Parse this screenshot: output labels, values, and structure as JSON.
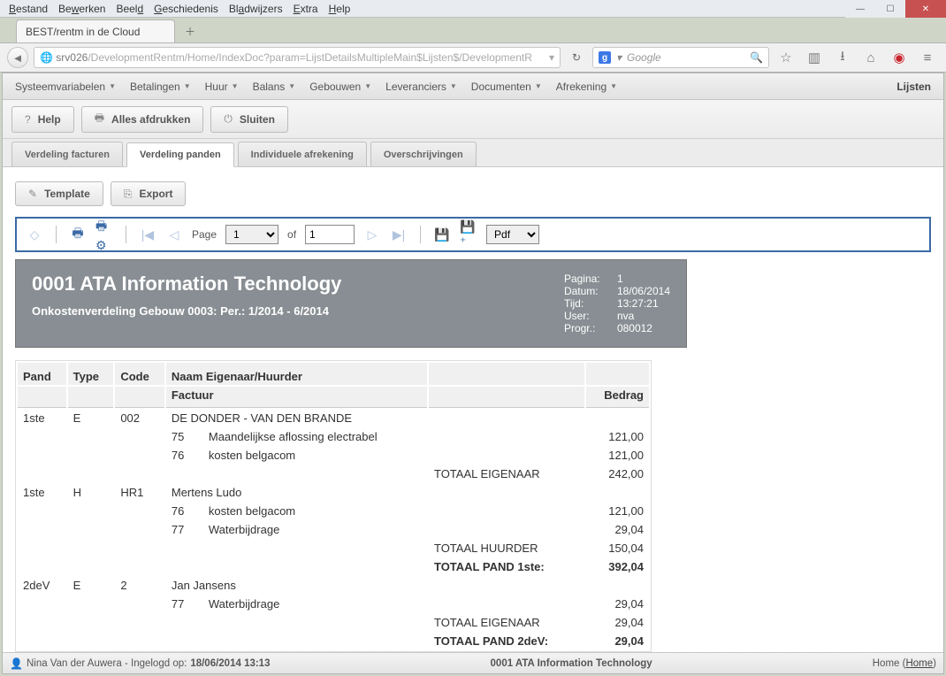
{
  "os_menu": [
    "Bestand",
    "Bewerken",
    "Beeld",
    "Geschiedenis",
    "Bladwijzers",
    "Extra",
    "Help"
  ],
  "browser": {
    "tab_title": "BEST/rentm in de Cloud",
    "url_host": "srv026",
    "url_path": "/DevelopmentRentm/Home/IndexDoc?param=LijstDetailsMultipleMain$Lijsten$/DevelopmentR",
    "search_placeholder": "Google"
  },
  "app_menu": [
    "Systeemvariabelen",
    "Betalingen",
    "Huur",
    "Balans",
    "Gebouwen",
    "Leveranciers",
    "Documenten",
    "Afrekening"
  ],
  "app_menu_right": "Lijsten",
  "actions": {
    "help": "Help",
    "print_all": "Alles afdrukken",
    "close": "Sluiten"
  },
  "sub_tabs": [
    "Verdeling facturen",
    "Verdeling panden",
    "Individuele afrekening",
    "Overschrijvingen"
  ],
  "active_sub_tab": 1,
  "tools": {
    "template": "Template",
    "export": "Export"
  },
  "pager": {
    "page_label": "Page",
    "page_value": "1",
    "of_label": "of",
    "total_value": "1",
    "format": "Pdf"
  },
  "report": {
    "title": "0001 ATA Information Technology",
    "subtitle": "Onkostenverdeling Gebouw 0003: Per.: 1/2014 - 6/2014",
    "meta": {
      "Pagina:": "1",
      "Datum:": "18/06/2014",
      "Tijd:": "13:27:21",
      "User:": "nva",
      "Progr.:": "080012"
    },
    "headers": {
      "pand": "Pand",
      "type": "Type",
      "code": "Code",
      "naam": "Naam Eigenaar/Huurder",
      "factuur": "Factuur",
      "bedrag": "Bedrag"
    },
    "rows": [
      {
        "pand": "1ste",
        "type": "E",
        "code": "002",
        "naam": "DE DONDER - VAN DEN BRANDE"
      },
      {
        "fnum": "75",
        "fdesc": "Maandelijkse aflossing electrabel",
        "amt": "121,00"
      },
      {
        "fnum": "76",
        "fdesc": "kosten belgacom",
        "amt": "121,00"
      },
      {
        "totlabel": "TOTAAL EIGENAAR",
        "amt": "242,00"
      },
      {
        "pand": "1ste",
        "type": "H",
        "code": "HR1",
        "naam": "Mertens Ludo"
      },
      {
        "fnum": "76",
        "fdesc": "kosten belgacom",
        "amt": "121,00"
      },
      {
        "fnum": "77",
        "fdesc": "Waterbijdrage",
        "amt": "29,04"
      },
      {
        "totlabel": "TOTAAL HUURDER",
        "amt": "150,04"
      },
      {
        "totlabel": "TOTAAL PAND 1ste:",
        "amt": "392,04",
        "bold": true
      },
      {
        "pand": "2deV",
        "type": "E",
        "code": "2",
        "naam": "Jan Jansens"
      },
      {
        "fnum": "77",
        "fdesc": "Waterbijdrage",
        "amt": "29,04"
      },
      {
        "totlabel": "TOTAAL EIGENAAR",
        "amt": "29,04"
      },
      {
        "totlabel": "TOTAAL PAND 2deV:",
        "amt": "29,04",
        "bold": true
      }
    ]
  },
  "status": {
    "user_line_prefix": "Nina Van der Auwera - Ingelogd op: ",
    "user_line_bold": "18/06/2014 13:13",
    "center": "0001 ATA Information Technology",
    "home": "Home",
    "home_link": "Home"
  }
}
